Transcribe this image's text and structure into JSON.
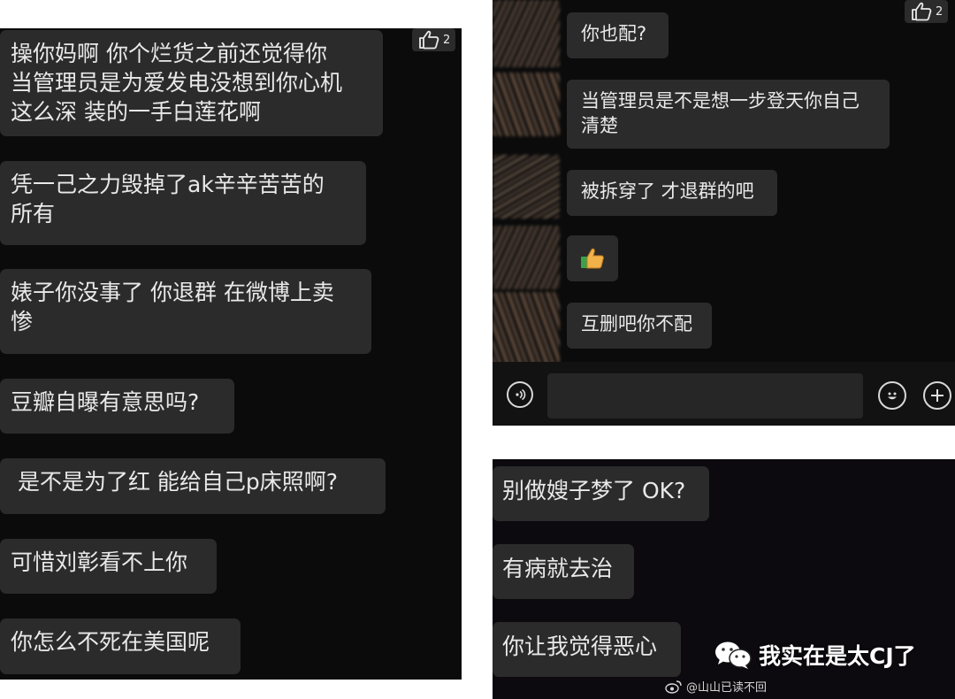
{
  "left_panel": {
    "like_count": "2",
    "messages": [
      "操你妈啊 你个烂货之前还觉得你\n当管理员是为爱发电没想到你心机\n这么深 装的一手白莲花啊",
      "凭一己之力毁掉了ak辛辛苦苦的\n所有",
      "婊子你没事了 你退群 在微博上卖\n惨",
      "豆瓣自曝有意思吗?",
      " 是不是为了红 能给自己p床照啊?",
      "可惜刘彰看不上你",
      "你怎么不死在美国呢"
    ]
  },
  "right_top_panel": {
    "like_count": "2",
    "messages": [
      "你也配?",
      "当管理员是不是想一步登天你自己\n清楚",
      "被拆穿了 才退群的吧",
      "互删吧你不配"
    ],
    "emoji_message": "thumbs-up-emoji",
    "input_bar": {
      "voice_icon": "voice-icon",
      "emoji_icon": "smiley-icon",
      "add_icon": "plus-icon"
    }
  },
  "right_bottom_panel": {
    "messages": [
      "别做嫂子梦了 OK?",
      "有病就去治",
      "你让我觉得恶心"
    ]
  },
  "watermark": {
    "account": "我实在是太CJ了",
    "weibo_handle": "@山山已读不回"
  },
  "colors": {
    "panel_bg": "#0b0b0b",
    "bubble_bg": "#2b2b2b",
    "text": "#e9e9e9"
  }
}
